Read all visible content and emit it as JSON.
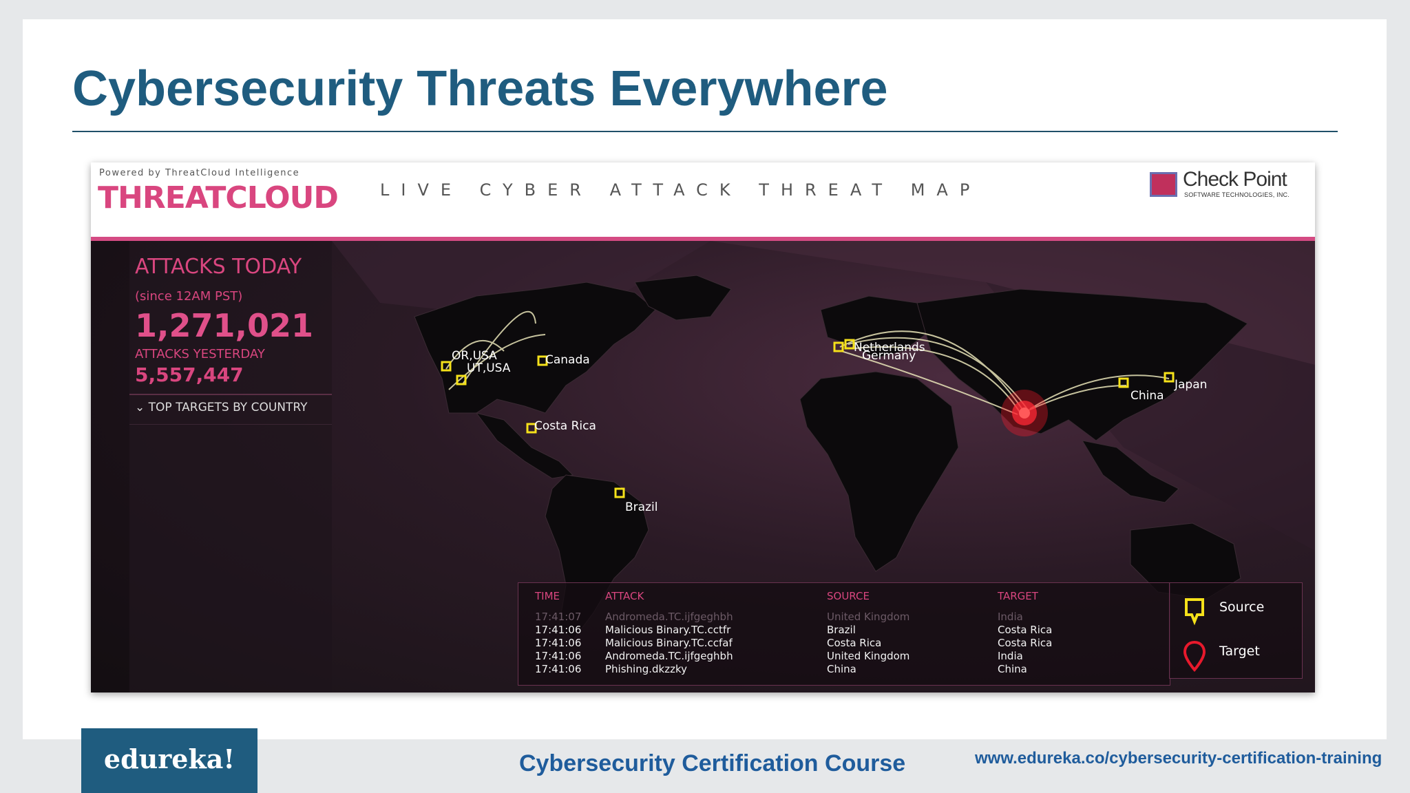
{
  "slide": {
    "title": "Cybersecurity Threats Everywhere"
  },
  "threatmap": {
    "powered_by": "Powered by ThreatCloud Intelligence",
    "brand": "THREATCLOUD",
    "title": "LIVE CYBER ATTACK THREAT MAP",
    "partner_name": "Check Point",
    "partner_sub": "SOFTWARE TECHNOLOGIES, INC.",
    "stats": {
      "attacks_today_label": "ATTACKS TODAY",
      "since": "(since 12AM PST)",
      "attacks_today": "1,271,021",
      "attacks_yesterday_label": "ATTACKS YESTERDAY",
      "attacks_yesterday": "5,557,447",
      "top_targets": "TOP TARGETS BY COUNTRY"
    },
    "locations": [
      "OR,USA",
      "UT,USA",
      "Canada",
      "Costa Rica",
      "Brazil",
      "Netherlands",
      "Germany",
      "China",
      "Japan"
    ],
    "feed": {
      "headers": {
        "time": "TIME",
        "attack": "ATTACK",
        "source": "SOURCE",
        "target": "TARGET"
      },
      "rows": [
        {
          "time": "17:41:07",
          "attack": "Andromeda.TC.ijfgeghbh",
          "source": "United Kingdom",
          "target": "India",
          "faded": true
        },
        {
          "time": "17:41:06",
          "attack": "Malicious Binary.TC.cctfr",
          "source": "Brazil",
          "target": "Costa Rica",
          "faded": false
        },
        {
          "time": "17:41:06",
          "attack": "Malicious Binary.TC.ccfaf",
          "source": "Costa Rica",
          "target": "Costa Rica",
          "faded": false
        },
        {
          "time": "17:41:06",
          "attack": "Andromeda.TC.ijfgeghbh",
          "source": "United Kingdom",
          "target": "India",
          "faded": false
        },
        {
          "time": "17:41:06",
          "attack": "Phishing.dkzzky",
          "source": "China",
          "target": "China",
          "faded": false
        }
      ]
    },
    "legend": {
      "source": "Source",
      "target": "Target"
    },
    "colors": {
      "accent": "#d9467f",
      "source_marker": "#f5e11a",
      "target_marker": "#e8192c"
    }
  },
  "footer": {
    "logo": "edureka!",
    "course": "Cybersecurity Certification Course",
    "url": "www.edureka.co/cybersecurity-certification-training"
  }
}
